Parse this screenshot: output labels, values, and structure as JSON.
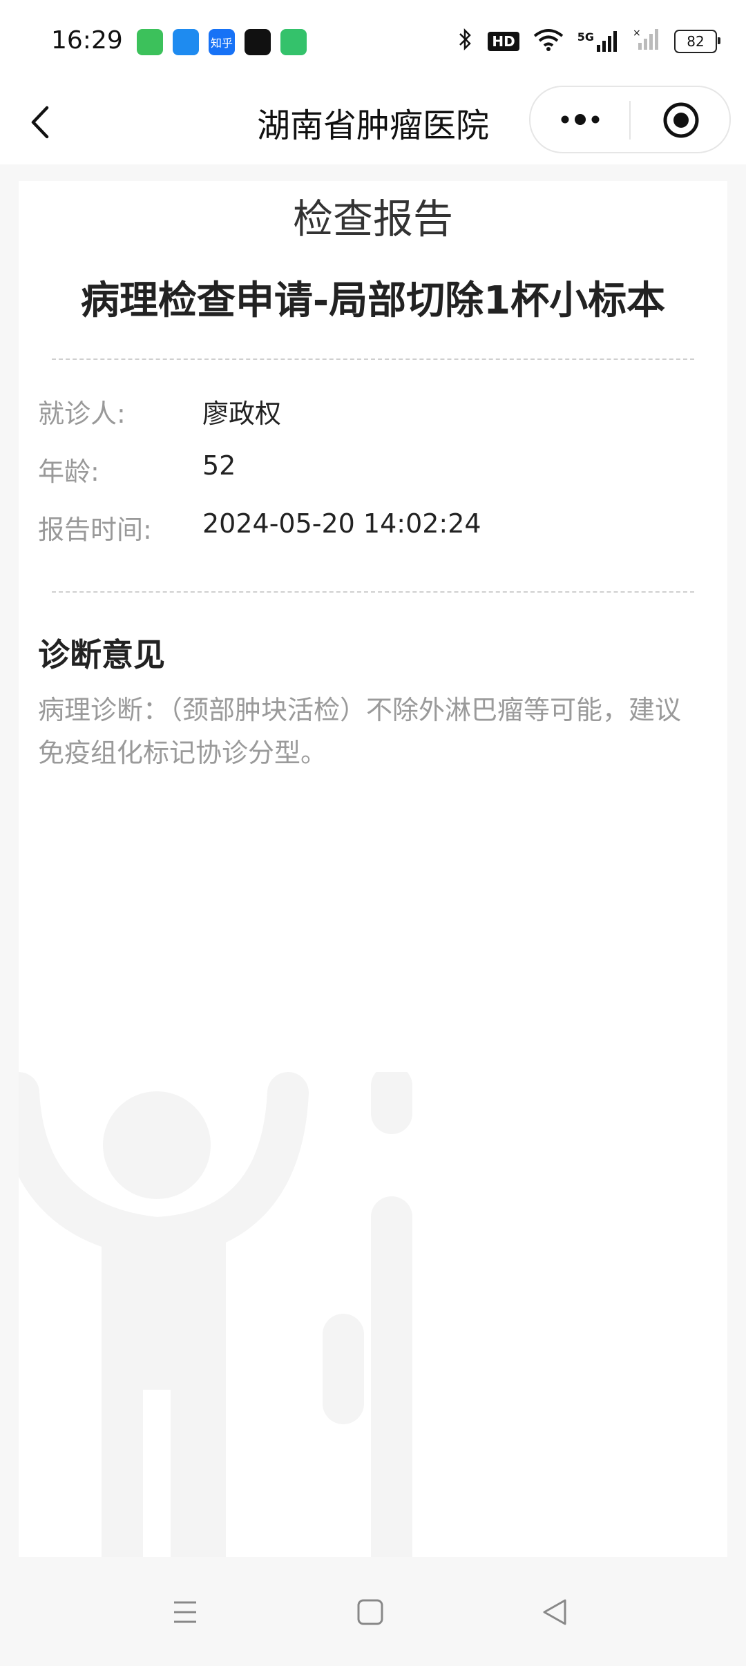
{
  "status_bar": {
    "time": "16:29",
    "apps": [
      {
        "icon": "message-app-icon",
        "color": "#3cc15b",
        "text": ""
      },
      {
        "icon": "phone-app-icon",
        "color": "#1e8bf0",
        "text": ""
      },
      {
        "icon": "zhihu-app-icon",
        "color": "#1772f6",
        "text": "知乎"
      },
      {
        "icon": "tiktok-app-icon",
        "color": "#111111",
        "text": ""
      },
      {
        "icon": "security-app-icon",
        "color": "#34c26b",
        "text": ""
      }
    ],
    "hd_label": "HD",
    "network_label": "5G",
    "battery": "82"
  },
  "navbar": {
    "title": "湖南省肿瘤医院"
  },
  "report": {
    "heading": "检查报告",
    "exam_title": "病理检查申请-局部切除1杯小标本",
    "fields": {
      "patient_label": "就诊人:",
      "patient_value": "廖政权",
      "age_label": "年龄:",
      "age_value": "52",
      "time_label": "报告时间:",
      "time_value": "2024-05-20 14:02:24"
    },
    "diagnosis_title": "诊断意见",
    "diagnosis_text": "病理诊断：（颈部肿块活检）不除外淋巴瘤等可能，建议免疫组化标记协诊分型。"
  },
  "colors": {
    "page_bg": "#f7f7f7",
    "card_bg": "#ffffff",
    "label_gray": "#999999",
    "text_dark": "#222222"
  }
}
